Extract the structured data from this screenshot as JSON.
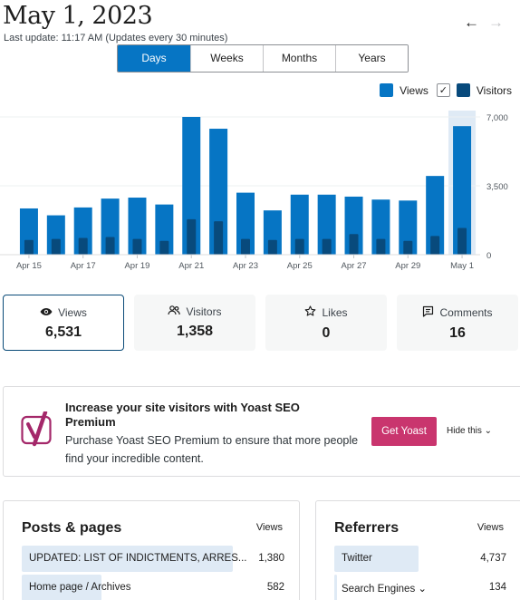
{
  "header": {
    "date": "May 1, 2023",
    "last_update": "Last update: 11:17 AM (Updates every 30 minutes)",
    "prev_arrow": "←",
    "next_arrow": "→"
  },
  "period_tabs": [
    {
      "label": "Days",
      "active": true
    },
    {
      "label": "Weeks",
      "active": false
    },
    {
      "label": "Months",
      "active": false
    },
    {
      "label": "Years",
      "active": false
    }
  ],
  "legend": {
    "views_label": "Views",
    "visitors_label": "Visitors",
    "visitors_checked": "✓"
  },
  "colors": {
    "views": "#0675c4",
    "visitors": "#084a7c",
    "highlight": "#dfeaf5",
    "accent": "#0675c4",
    "promo_cta": "#c9356e"
  },
  "chart_data": {
    "type": "bar",
    "categories": [
      "Apr 15",
      "Apr 16",
      "Apr 17",
      "Apr 18",
      "Apr 19",
      "Apr 20",
      "Apr 21",
      "Apr 22",
      "Apr 23",
      "Apr 24",
      "Apr 25",
      "Apr 26",
      "Apr 27",
      "Apr 28",
      "Apr 29",
      "Apr 30",
      "May 1"
    ],
    "tick_labels": [
      "Apr 15",
      "",
      "Apr 17",
      "",
      "Apr 19",
      "",
      "Apr 21",
      "",
      "Apr 23",
      "",
      "Apr 25",
      "",
      "Apr 27",
      "",
      "Apr 29",
      "",
      "May 1"
    ],
    "series": [
      {
        "name": "Views",
        "values": [
          2350,
          2000,
          2400,
          2850,
          2900,
          2550,
          7000,
          6400,
          3150,
          2250,
          3050,
          3050,
          2950,
          2800,
          2750,
          4000,
          6531
        ]
      },
      {
        "name": "Visitors",
        "values": [
          750,
          800,
          850,
          900,
          800,
          700,
          1800,
          1700,
          800,
          750,
          800,
          800,
          1050,
          800,
          700,
          950,
          1358
        ]
      }
    ],
    "y_ticks": [
      "0",
      "3,500",
      "7,000"
    ],
    "ylim": [
      0,
      7000
    ],
    "highlighted_category": "May 1",
    "grid": true,
    "legend_position": "top-right"
  },
  "stats": [
    {
      "icon": "eye-icon",
      "glyph": "👁",
      "label": "Views",
      "value": "6,531",
      "active": true
    },
    {
      "icon": "people-icon",
      "glyph": "👥",
      "label": "Visitors",
      "value": "1,358",
      "active": false
    },
    {
      "icon": "star-icon",
      "glyph": "☆",
      "label": "Likes",
      "value": "0",
      "active": false
    },
    {
      "icon": "comment-icon",
      "glyph": "🗨",
      "label": "Comments",
      "value": "16",
      "active": false
    }
  ],
  "promo": {
    "heading": "Increase your site visitors with Yoast SEO Premium",
    "description": "Purchase Yoast SEO Premium to ensure that more people find your incredible content.",
    "cta": "Get Yoast",
    "hide": "Hide this ⌄"
  },
  "posts": {
    "title": "Posts & pages",
    "column": "Views",
    "rows": [
      {
        "label": "UPDATED: LIST OF INDICTMENTS, ARRES...",
        "value": "1,380",
        "fraction": 0.93
      },
      {
        "label": "Home page / Archives",
        "value": "582",
        "fraction": 0.35
      }
    ]
  },
  "referrers": {
    "title": "Referrers",
    "column": "Views",
    "rows": [
      {
        "label": "Twitter",
        "value": "4,737",
        "fraction": 0.62
      },
      {
        "label": "Search Engines ⌄",
        "value": "134",
        "fraction": 0.02
      }
    ]
  }
}
